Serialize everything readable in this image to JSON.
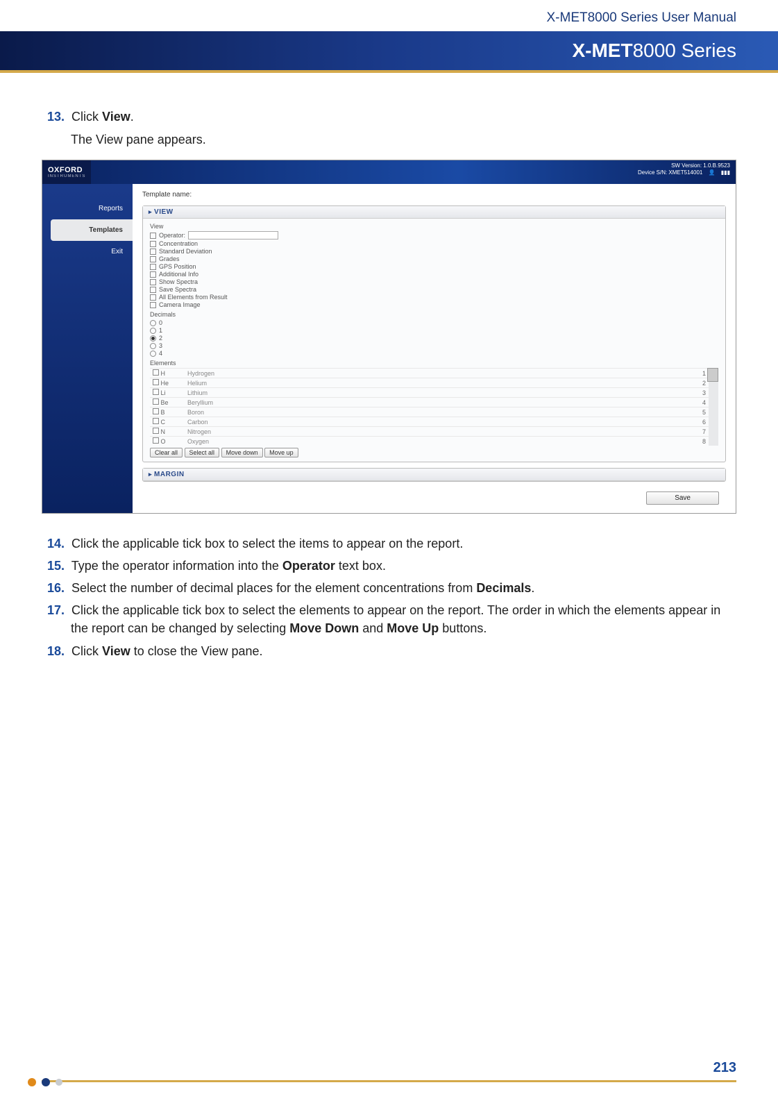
{
  "header": {
    "manual_title": "X-MET8000 Series User Manual",
    "banner_bold": "X-MET",
    "banner_light": "8000 Series"
  },
  "steps": {
    "s13": {
      "num": "13.",
      "text_a": "Click ",
      "bold_a": "View",
      "text_b": "."
    },
    "s13_sub": "The View pane appears.",
    "s14": {
      "num": "14.",
      "text": "Click the applicable tick box to select the items to appear on the report."
    },
    "s15": {
      "num": "15.",
      "text_a": "Type the operator information into the ",
      "bold_a": "Operator",
      "text_b": " text box."
    },
    "s16": {
      "num": "16.",
      "text_a": "Select the number of decimal places for the element concentrations from ",
      "bold_a": "Decimals",
      "text_b": "."
    },
    "s17": {
      "num": "17.",
      "text_a": "Click the applicable tick box to select the elements to appear on the report. The order in which the elements appear in the report can be changed by selecting ",
      "bold_a": "Move Down",
      "text_b": " and ",
      "bold_b": "Move Up",
      "text_c": " buttons."
    },
    "s18": {
      "num": "18.",
      "text_a": "Click ",
      "bold_a": "View",
      "text_b": " to close the View pane."
    }
  },
  "screenshot": {
    "logo_top": "OXFORD",
    "logo_sub": "INSTRUMENTS",
    "sw_version": "SW Version: 1.0.B.9523",
    "device_sn": "Device S/N: XMET514001",
    "sidebar": {
      "reports": "Reports",
      "templates": "Templates",
      "exit": "Exit"
    },
    "tpl_label": "Template name:",
    "view_hd": "VIEW",
    "view_sub": "View",
    "checks": {
      "operator": "Operator:",
      "concentration": "Concentration",
      "stddev": "Standard Deviation",
      "grades": "Grades",
      "gps": "GPS Position",
      "addinfo": "Additional Info",
      "showspec": "Show Spectra",
      "savespec": "Save Spectra",
      "allelem": "All Elements from Result",
      "camera": "Camera Image"
    },
    "decimals_hd": "Decimals",
    "decimals": {
      "d0": "0",
      "d1": "1",
      "d2": "2",
      "d3": "3",
      "d4": "4"
    },
    "elements_hd": "Elements",
    "elements": [
      {
        "sym": "H",
        "name": "Hydrogen",
        "num": "1"
      },
      {
        "sym": "He",
        "name": "Helium",
        "num": "2"
      },
      {
        "sym": "Li",
        "name": "Lithium",
        "num": "3"
      },
      {
        "sym": "Be",
        "name": "Beryllium",
        "num": "4"
      },
      {
        "sym": "B",
        "name": "Boron",
        "num": "5"
      },
      {
        "sym": "C",
        "name": "Carbon",
        "num": "6"
      },
      {
        "sym": "N",
        "name": "Nitrogen",
        "num": "7"
      },
      {
        "sym": "O",
        "name": "Oxygen",
        "num": "8"
      }
    ],
    "buttons": {
      "clear": "Clear all",
      "select": "Select all",
      "movedown": "Move down",
      "moveup": "Move up"
    },
    "margin_hd": "MARGIN",
    "save": "Save"
  },
  "footer": {
    "page": "213"
  }
}
